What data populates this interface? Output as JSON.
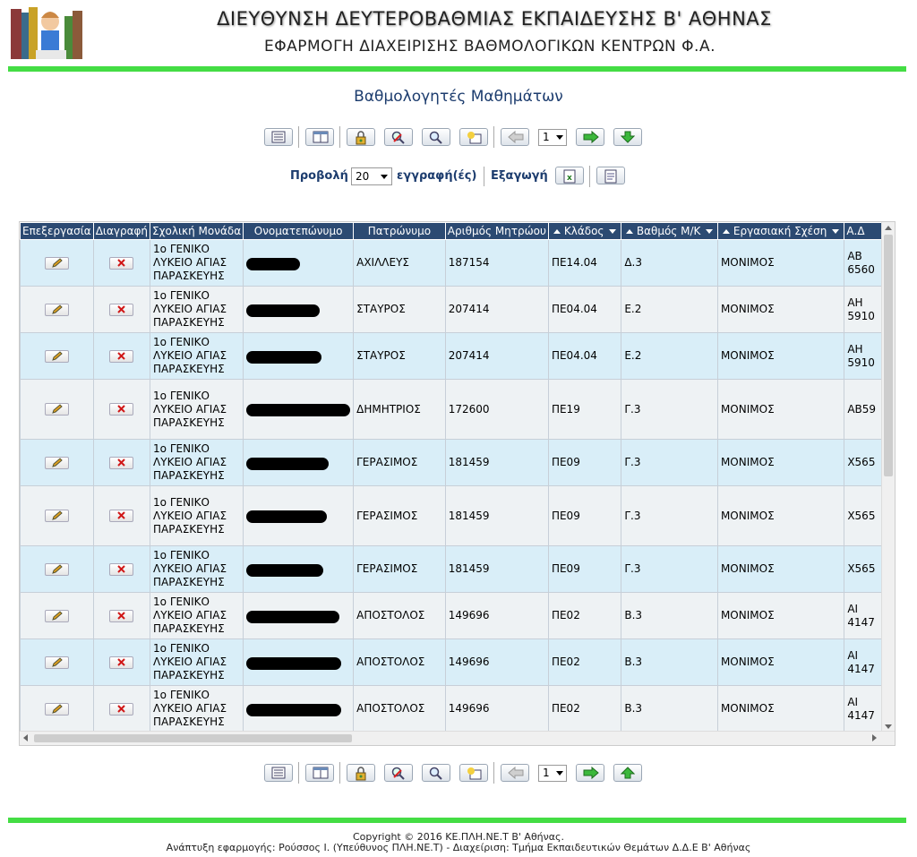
{
  "header": {
    "title_line1": "ΔΙΕΥΘΥΝΣΗ ΔΕΥΤΕΡΟΒΑΘΜΙΑΣ ΕΚΠΑΙΔΕΥΣΗΣ Β' ΑΘΗΝΑΣ",
    "title_line2": "ΕΦΑΡΜΟΓΗ ΔΙΑΧΕΙΡΙΣΗΣ ΒΑΘΜΟΛΟΓΙΚΩΝ ΚΕΝΤΡΩΝ Φ.Α.",
    "accent_color": "#44dd44"
  },
  "page": {
    "title": "Βαθμολογητές Μαθημάτων"
  },
  "toolbar": {
    "icons": [
      "list-icon",
      "table-view-icon",
      "lock-key-icon",
      "clear-search-icon",
      "search-icon",
      "new-record-icon",
      "prev-page-icon",
      "next-page-icon",
      "down-arrow-icon"
    ],
    "page_value": "1"
  },
  "view": {
    "label": "Προβολή",
    "per_page_value": "20",
    "records_label": "εγγραφή(ές)",
    "export_label": "Εξαγωγή"
  },
  "grid": {
    "columns": [
      "Επεξεργασία",
      "Διαγραφή",
      "Σχολική Μονάδα",
      "Ονοματεπώνυμο",
      "Πατρώνυμο",
      "Αριθμός Μητρώου",
      "Κλάδος",
      "Βαθμός Μ/Κ",
      "Εργασιακή Σχέση",
      "Α.Δ"
    ],
    "school_lines": [
      "1ο ΓΕΝΙΚΟ",
      "ΛΥΚΕΙΟ ΑΓΙΑΣ",
      "ΠΑΡΑΣΚΕΥΗΣ"
    ],
    "rows": [
      {
        "patronymic": "ΑΧΙΛΛΕΥΣ",
        "registry": "187154",
        "branch": "ΠΕ14.04",
        "grade": "Δ.3",
        "relation": "ΜΟΝΙΜΟΣ",
        "id1": "ΑΒ",
        "id2": "6560"
      },
      {
        "patronymic": "ΣΤΑΥΡΟΣ",
        "registry": "207414",
        "branch": "ΠΕ04.04",
        "grade": "Ε.2",
        "relation": "ΜΟΝΙΜΟΣ",
        "id1": "ΑΗ",
        "id2": "5910"
      },
      {
        "patronymic": "ΣΤΑΥΡΟΣ",
        "registry": "207414",
        "branch": "ΠΕ04.04",
        "grade": "Ε.2",
        "relation": "ΜΟΝΙΜΟΣ",
        "id1": "ΑΗ",
        "id2": "5910"
      },
      {
        "patronymic": "ΔΗΜΗΤΡΙΟΣ",
        "registry": "172600",
        "branch": "ΠΕ19",
        "grade": "Γ.3",
        "relation": "ΜΟΝΙΜΟΣ",
        "id1": "ΑΒ59",
        "id2": ""
      },
      {
        "patronymic": "ΓΕΡΑΣΙΜΟΣ",
        "registry": "181459",
        "branch": "ΠΕ09",
        "grade": "Γ.3",
        "relation": "ΜΟΝΙΜΟΣ",
        "id1": "Χ565",
        "id2": ""
      },
      {
        "patronymic": "ΓΕΡΑΣΙΜΟΣ",
        "registry": "181459",
        "branch": "ΠΕ09",
        "grade": "Γ.3",
        "relation": "ΜΟΝΙΜΟΣ",
        "id1": "Χ565",
        "id2": ""
      },
      {
        "patronymic": "ΓΕΡΑΣΙΜΟΣ",
        "registry": "181459",
        "branch": "ΠΕ09",
        "grade": "Γ.3",
        "relation": "ΜΟΝΙΜΟΣ",
        "id1": "Χ565",
        "id2": ""
      },
      {
        "patronymic": "ΑΠΟΣΤΟΛΟΣ",
        "registry": "149696",
        "branch": "ΠΕ02",
        "grade": "Β.3",
        "relation": "ΜΟΝΙΜΟΣ",
        "id1": "ΑΙ",
        "id2": "4147"
      },
      {
        "patronymic": "ΑΠΟΣΤΟΛΟΣ",
        "registry": "149696",
        "branch": "ΠΕ02",
        "grade": "Β.3",
        "relation": "ΜΟΝΙΜΟΣ",
        "id1": "ΑΙ",
        "id2": "4147"
      },
      {
        "patronymic": "ΑΠΟΣΤΟΛΟΣ",
        "registry": "149696",
        "branch": "ΠΕ02",
        "grade": "Β.3",
        "relation": "ΜΟΝΙΜΟΣ",
        "id1": "ΑΙ",
        "id2": "4147"
      }
    ]
  },
  "footer": {
    "copyright": "Copyright © 2016 ΚΕ.ΠΛΗ.ΝΕ.Τ Β' Αθήνας.",
    "credits": "Ανάπτυξη εφαρμογής: Ρούσσος Ι. (Υπεύθυνος ΠΛΗ.ΝΕ.Τ) - Διαχείριση: Τμήμα Εκπαιδευτικών Θεμάτων Δ.Δ.Ε Β' Αθήνας"
  }
}
